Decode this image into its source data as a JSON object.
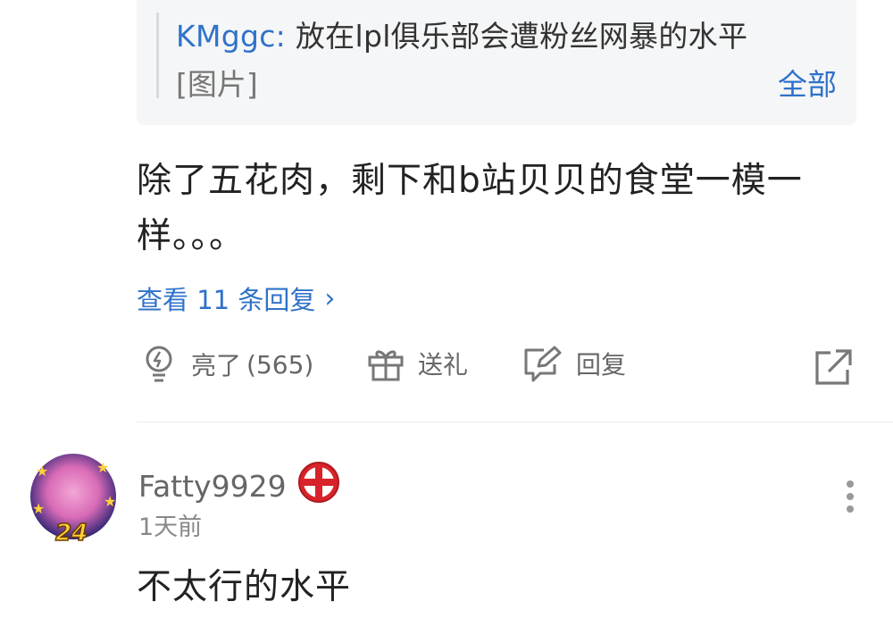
{
  "quote": {
    "author": "KMggc:",
    "text": "放在lpl俱乐部会遭粉丝网暴的水平",
    "image_placeholder": "[图片]",
    "all_label": "全部"
  },
  "comment": {
    "text": "除了五花肉，剩下和b站贝贝的食堂一模一样。。。",
    "view_replies": "查看 11 条回复",
    "actions": {
      "like_label": "亮了",
      "like_count": "(565)",
      "gift_label": "送礼",
      "reply_label": "回复"
    }
  },
  "next_comment": {
    "username": "Fatty9929",
    "avatar_badge": "24",
    "time": "1天前",
    "text": "不太行的水平"
  },
  "colors": {
    "link": "#2f72c9",
    "muted": "#666666",
    "quote_bg": "#f5f6f7",
    "flag_red": "#d8232a"
  }
}
